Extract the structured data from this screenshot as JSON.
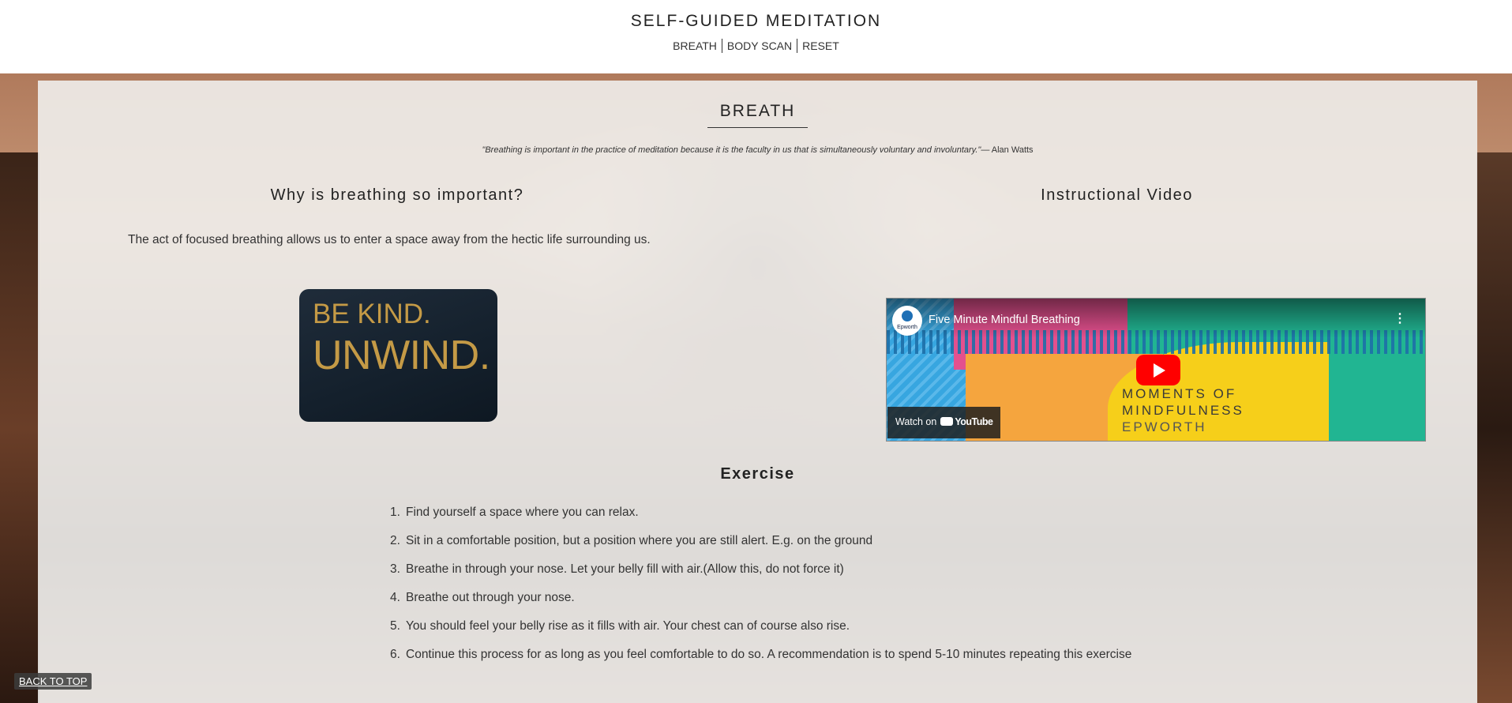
{
  "header": {
    "title": "SELF-GUIDED MEDITATION",
    "nav": [
      "BREATH",
      "BODY SCAN",
      "RESET"
    ]
  },
  "section": {
    "title": "BREATH",
    "quote": "\"Breathing is important in the practice of meditation because it is the faculty in us that is simultaneously voluntary and involuntary.\"",
    "quote_author": "— Alan Watts"
  },
  "left": {
    "heading": "Why is breathing so important?",
    "text": "The act of focused breathing allows us to enter a space away from the hectic life surrounding us.",
    "image_line1": "BE KIND.",
    "image_line2": "UNWIND."
  },
  "right": {
    "heading": "Instructional Video",
    "video_title": "Five Minute Mindful Breathing",
    "channel_logo_text": "Epworth",
    "overlay_line1": "MOMENTS OF",
    "overlay_line2": "MINDFULNESS",
    "overlay_line3": "EPWORTH",
    "watch_on": "Watch on",
    "youtube": "YouTube"
  },
  "exercise": {
    "title": "Exercise",
    "steps": [
      "Find yourself a space where you can relax.",
      "Sit in a comfortable position, but a position where you are still alert. E.g. on the ground",
      "Breathe in through your nose. Let your belly fill with air.(Allow this, do not force it)",
      "Breathe out through your nose.",
      "You should feel your belly rise as it fills with air. Your chest can of course also rise.",
      "Continue this process for as long as you feel comfortable to do so. A recommendation is to spend 5-10 minutes repeating this exercise"
    ]
  },
  "back_to_top": "BACK TO TOP",
  "colors": {
    "image_gold": "#c49a46",
    "youtube_red": "#ff0000",
    "video_teal": "#21b592"
  }
}
